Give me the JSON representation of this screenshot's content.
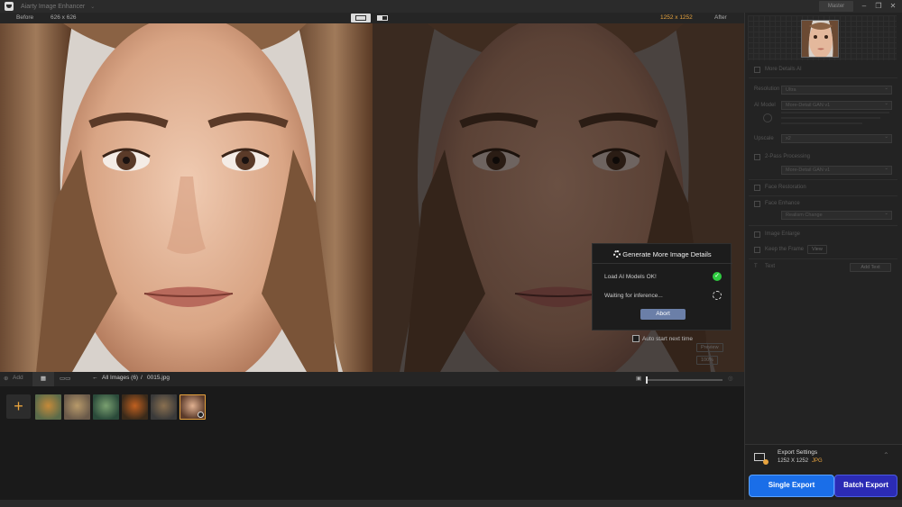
{
  "titlebar": {
    "app_title": "Aiarty Image Enhancer",
    "mode_button": "Master"
  },
  "viewer": {
    "before_label": "Before",
    "before_size": "626 x 626",
    "after_size": "1252 x 1252",
    "after_label": "After"
  },
  "dialog": {
    "title": "Generate More Image Details",
    "status_rows": [
      {
        "label": "Load AI Models OK!",
        "state": "done"
      },
      {
        "label": "Waiting for inference...",
        "state": "pending"
      }
    ],
    "abort_label": "Abort",
    "auto_start_label": "Auto start next time"
  },
  "viewer_controls": {
    "preview_label": "Preview",
    "zoom_label": "100%"
  },
  "thumb_toolbar": {
    "add_label": "Add",
    "breadcrumb_root": "All Images (6)",
    "breadcrumb_sep": "/",
    "breadcrumb_file": "0015.jpg",
    "zoom_level": 0.0
  },
  "thumbnails": [
    {
      "color_a": "#5a6b4a",
      "color_b": "#c58a3a"
    },
    {
      "color_a": "#6a5a4a",
      "color_b": "#b89a6a"
    },
    {
      "color_a": "#2a4a3a",
      "color_b": "#7aa070"
    },
    {
      "color_a": "#3a2a1a",
      "color_b": "#c06020"
    },
    {
      "color_a": "#3a3a3a",
      "color_b": "#8a7050"
    },
    {
      "color_a": "#5a3a2a",
      "color_b": "#e0b090",
      "selected": true
    }
  ],
  "side": {
    "more_details": "More Details AI",
    "resolution_label": "Resolution",
    "resolution_value": "Ultra",
    "ai_model_label": "AI Model",
    "ai_model_value": "More-Detail GAN  v1",
    "upscale_label": "Upscale",
    "upscale_value": "x2",
    "two_pass_label": "2-Pass Processing",
    "two_pass_value": "More-Detail GAN  v1",
    "face_restore_label": "Face Restoration",
    "face_enhance_label": "Face Enhance",
    "face_enhance_value": "Realism Change",
    "image_enlarge_label": "Image Enlarge",
    "keep_frame_label": "Keep the Frame",
    "keep_frame_value": "View",
    "text_label": "Text",
    "add_text_label": "Add Text"
  },
  "export": {
    "title": "Export Settings",
    "size": "1252 X 1252",
    "format": "JPG",
    "single_label": "Single Export",
    "batch_label": "Batch Export"
  },
  "colors": {
    "accent": "#e7a33e",
    "single_export": "#1a6ee8",
    "batch_export": "#2b2bb5",
    "ok_green": "#2ecc40"
  }
}
